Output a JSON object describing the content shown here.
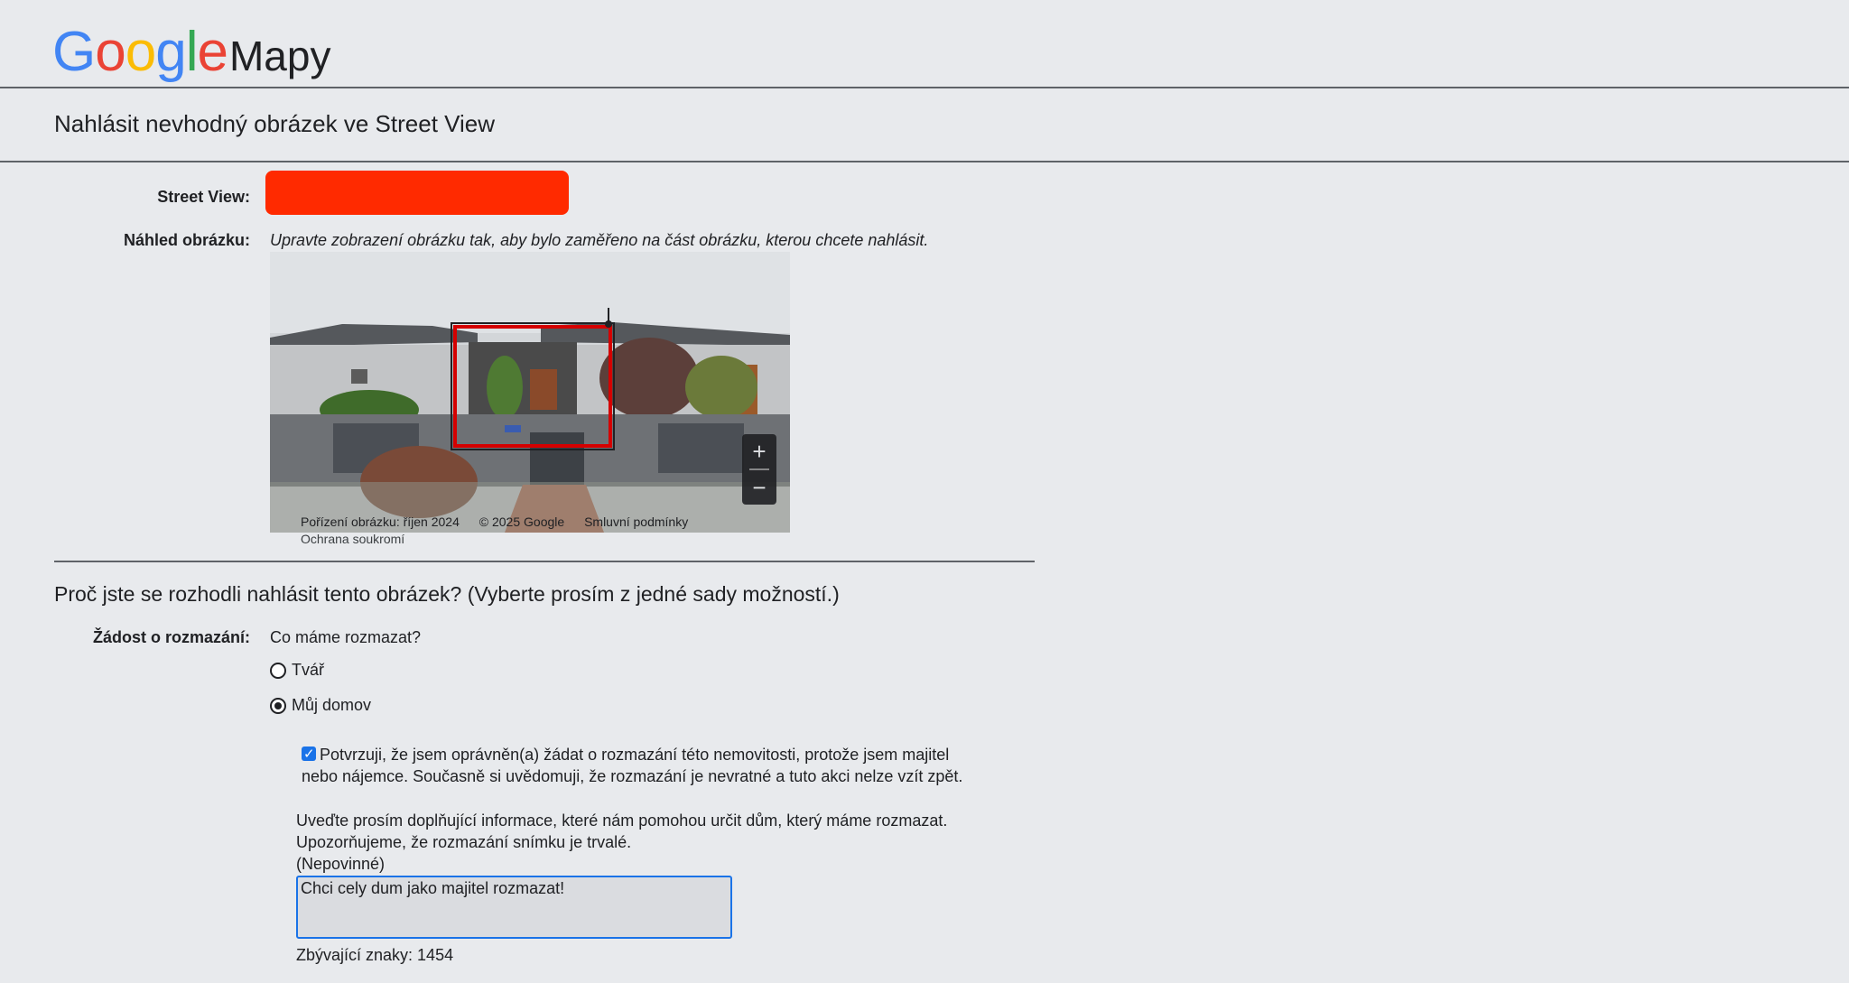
{
  "header": {
    "logo_text": "Google",
    "product": "Mapy"
  },
  "page": {
    "title": "Nahlásit nevhodný obrázek ve Street View"
  },
  "form": {
    "street_view_label": "Street View:",
    "preview_label": "Náhled obrázku:",
    "preview_hint": "Upravte zobrazení obrázku tak, aby bylo zaměřeno na část obrázku, kterou chcete nahlásit.",
    "preview": {
      "capture_date": "Pořízení obrázku: říjen 2024",
      "copyright": "© 2025 Google",
      "terms": "Smluvní podmínky",
      "privacy": "Ochrana soukromí",
      "zoom_in": "+",
      "zoom_out": "−"
    },
    "question": "Proč jste se rozhodli nahlásit tento obrázek?  (Vyberte prosím z jedné sady možností.)",
    "blur_label": "Žádost o rozmazání:",
    "blur_question": "Co máme rozmazat?",
    "options": [
      {
        "label": "Tvář",
        "checked": false
      },
      {
        "label": "Můj domov",
        "checked": true
      }
    ],
    "confirm_checked": true,
    "confirm_text": "Potvrzuji, že jsem oprávněn(a) žádat o rozmazání této nemovitosti, protože jsem majitel nebo nájemce. Současně si uvědomuji, že rozmazání je nevratné a tuto akci nelze vzít zpět.",
    "info_line1": "Uveďte prosím doplňující informace, které nám pomohou určit dům, který máme rozmazat.",
    "info_line2": "Upozorňujeme, že rozmazání snímku je trvalé.",
    "info_optional": "(Nepovinné)",
    "textarea_value": "Chci cely dum jako majitel rozmazat!",
    "remaining": "Zbývající znaky: 1454"
  },
  "colors": {
    "redaction": "#ff2a00",
    "selection_box": "#d50000",
    "accent": "#1a73e8"
  }
}
